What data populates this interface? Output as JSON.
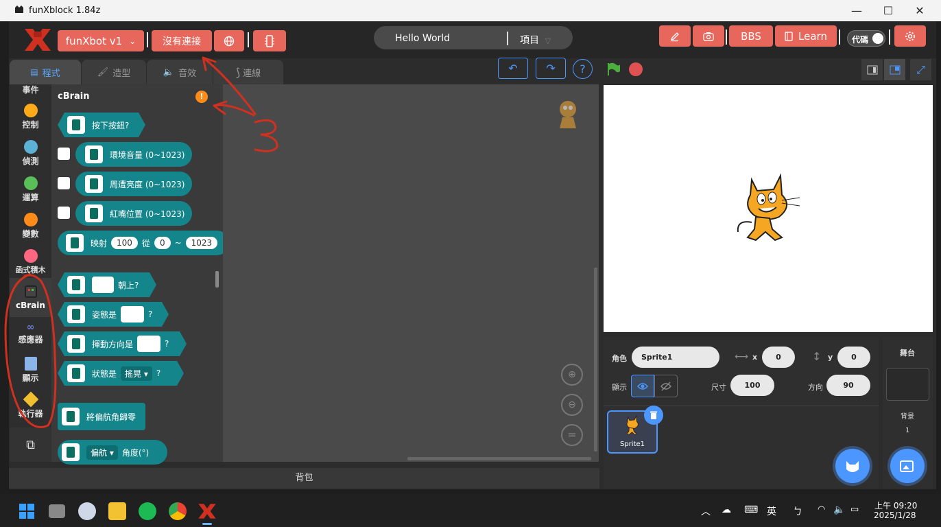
{
  "window": {
    "title": "funXblock 1.84z",
    "min": "—",
    "max": "☐",
    "close": "✕"
  },
  "menubar": {
    "device": "funXbot v1",
    "device_chevron": "⌄",
    "connect": "沒有連接",
    "project_title": "Hello World",
    "project_menu": "項目",
    "bbs": "BBS",
    "learn": "Learn",
    "code_toggle": "代碼"
  },
  "tabs": [
    {
      "label": "程式"
    },
    {
      "label": "造型"
    },
    {
      "label": "音效"
    },
    {
      "label": "連線"
    }
  ],
  "categories": [
    {
      "label": "事件",
      "color": ""
    },
    {
      "label": "控制",
      "color": "#ffab19"
    },
    {
      "label": "偵測",
      "color": "#5cb1d6"
    },
    {
      "label": "運算",
      "color": "#59c059"
    },
    {
      "label": "變數",
      "color": "#ff8c1a"
    },
    {
      "label": "函式積木",
      "color": "#ff6680"
    },
    {
      "label": "cBrain",
      "color": ""
    },
    {
      "label": "感應器",
      "color": ""
    },
    {
      "label": "顯示",
      "color": ""
    },
    {
      "label": "執行器",
      "color": ""
    }
  ],
  "palette": {
    "section": "cBrain",
    "blocks": {
      "button": "按下按鈕?",
      "sound": "環境音量 (0~1023)",
      "light": "周遭亮度 (0~1023)",
      "ir": "紅嘴位置 (0~1023)",
      "map_label": "映射",
      "map_v1": "100",
      "map_from": "從",
      "map_v2": "0",
      "map_tilde": "~",
      "map_v3": "1023",
      "face_up": "朝上?",
      "posture": "姿態是",
      "swing": "揮動方向是",
      "state": "狀態是",
      "state_value": "搖晃",
      "q": "?",
      "reset_yaw": "將偏航角歸零",
      "yaw": "偏航",
      "angle": "角度(°)"
    }
  },
  "workspace": {
    "backpack": "背包",
    "zoom_reset": "="
  },
  "sprite": {
    "label_sprite": "角色",
    "name": "Sprite1",
    "label_x": "x",
    "x": "0",
    "label_y": "y",
    "y": "0",
    "label_show": "顯示",
    "label_size": "尺寸",
    "size": "100",
    "label_dir": "方向",
    "direction": "90",
    "tile_name": "Sprite1"
  },
  "stage_panel": {
    "title": "舞台",
    "backdrop_label": "背景",
    "backdrop_count": "1"
  },
  "annotation": {
    "number": "3"
  },
  "taskbar": {
    "ime": "英",
    "time": "上午 09:20",
    "date": "2025/1/28"
  },
  "colors": {
    "accent": "#e8675c",
    "block": "#14868b",
    "selected": "#4c97ff"
  }
}
